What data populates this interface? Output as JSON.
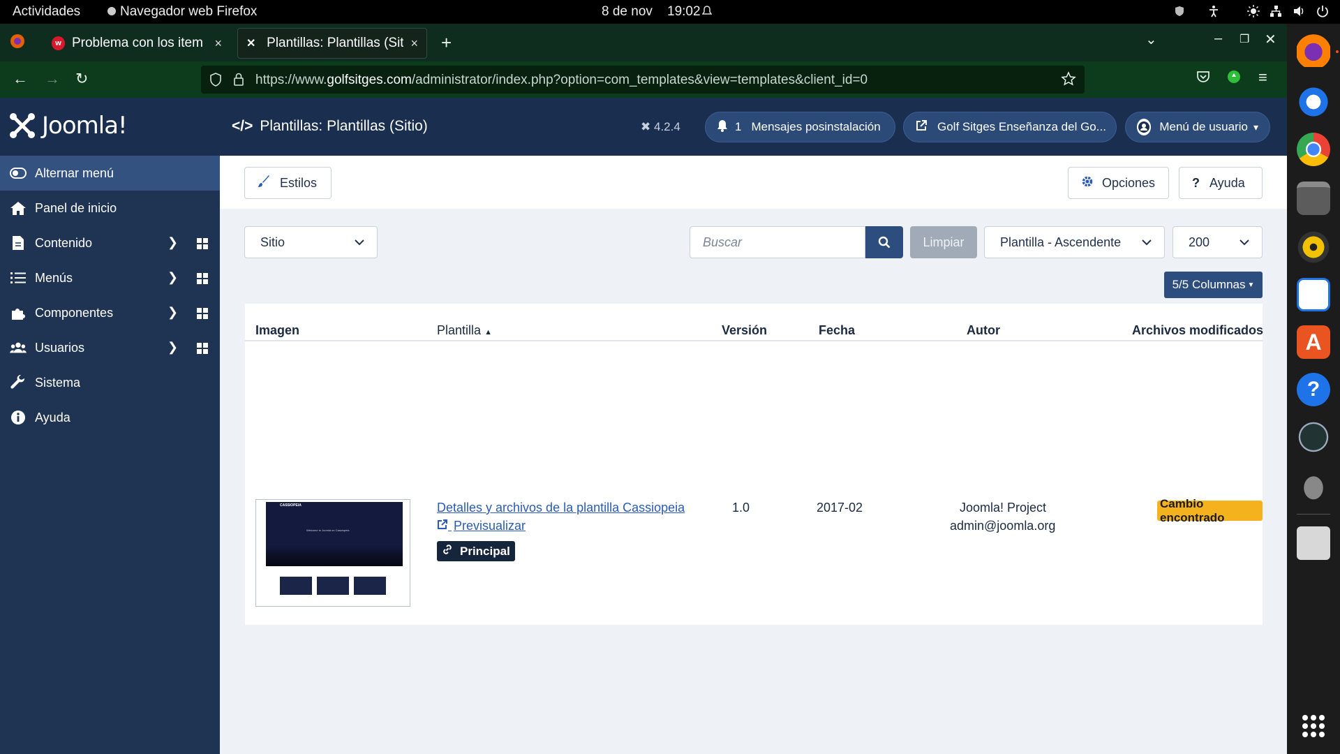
{
  "topbar": {
    "activities": "Actividades",
    "app_name": "Navegador web Firefox",
    "date": "8 de nov",
    "time": "19:02"
  },
  "browser": {
    "tabs": [
      {
        "title": "Problema con los item de",
        "active": false
      },
      {
        "title": "Plantillas: Plantillas (Sitio",
        "active": true
      }
    ],
    "url_prefix": "https://www.",
    "url_domain": "golfsitges.com",
    "url_path": "/administrator/index.php?option=com_templates&view=templates&client_id=0"
  },
  "header": {
    "logo": "Joomla!",
    "page_title": "Plantillas: Plantillas (Sitio)",
    "version": "4.2.4",
    "notification_count": "1",
    "postinstall_label": "Mensajes posinstalación",
    "site_label": "Golf Sitges Enseñanza del Go...",
    "user_menu_label": "Menú de usuario"
  },
  "sidebar": {
    "items": [
      {
        "label": "Alternar menú",
        "icon": "toggle-icon"
      },
      {
        "label": "Panel de inicio",
        "icon": "home-icon"
      },
      {
        "label": "Contenido",
        "icon": "file-icon"
      },
      {
        "label": "Menús",
        "icon": "list-icon"
      },
      {
        "label": "Componentes",
        "icon": "puzzle-icon"
      },
      {
        "label": "Usuarios",
        "icon": "users-icon"
      },
      {
        "label": "Sistema",
        "icon": "wrench-icon"
      },
      {
        "label": "Ayuda",
        "icon": "info-icon"
      }
    ]
  },
  "toolbar": {
    "styles_label": "Estilos",
    "options_label": "Opciones",
    "help_label": "Ayuda"
  },
  "filters": {
    "client_select": "Sitio",
    "search_placeholder": "Buscar",
    "clear_label": "Limpiar",
    "sort_select": "Plantilla - Ascendente",
    "limit_select": "200",
    "columns_label": "5/5 Columnas"
  },
  "table": {
    "headers": [
      "Imagen",
      "Plantilla",
      "Versión",
      "Fecha",
      "Autor",
      "Archivos modificados"
    ],
    "rows": [
      {
        "details_link": "Detalles y archivos de la plantilla Cassiopeia",
        "preview_link": "Previsualizar",
        "default_badge": "Principal",
        "version": "1.0",
        "date": "2017-02",
        "author": "Joomla! Project",
        "author_email": "admin@joomla.org",
        "status": "Cambio encontrado",
        "thumb_brand": "CASSIOPEIA",
        "thumb_hero_text": "Welcome to Joomla on Cassiopeia"
      }
    ]
  },
  "colors": {
    "sidebar_bg": "#1f3352",
    "header_bg": "#1a2f4f",
    "primary": "#2c4d7d",
    "warning": "#f5b21f",
    "link": "#2a5bb8"
  }
}
